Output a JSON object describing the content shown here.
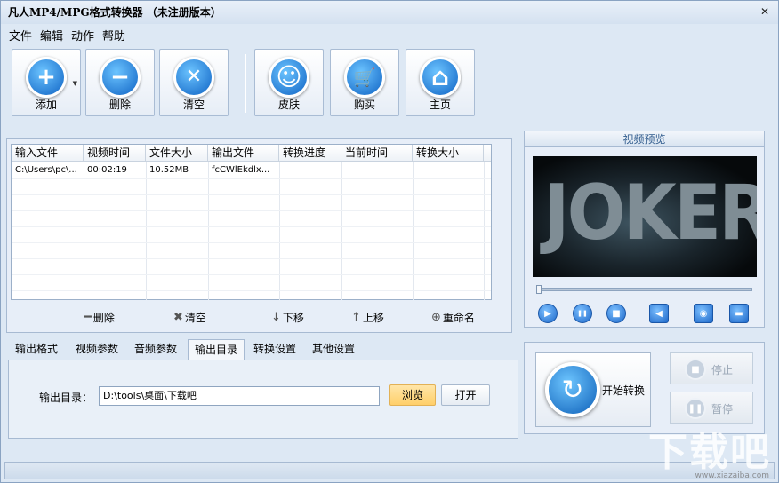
{
  "window": {
    "title": "凡人MP4/MPG格式转换器 （未注册版本）",
    "minimize_glyph": "—",
    "close_glyph": "✕"
  },
  "menu": [
    "文件",
    "编辑",
    "动作",
    "帮助"
  ],
  "toolbar": [
    {
      "label": "添加",
      "icon": "plus-icon",
      "color": "#1f7fe0",
      "glyph": "+"
    },
    {
      "label": "删除",
      "icon": "minus-icon",
      "color": "#1f7fe0",
      "glyph": "−"
    },
    {
      "label": "清空",
      "icon": "clear-icon",
      "color": "#1f7fe0",
      "glyph": "✕"
    },
    {
      "label": "皮肤",
      "icon": "smiley-icon",
      "color": "#1f7fe0",
      "glyph": "☺"
    },
    {
      "label": "购买",
      "icon": "cart-icon",
      "color": "#1f7fe0",
      "glyph": "🛒"
    },
    {
      "label": "主页",
      "icon": "home-icon",
      "color": "#1f7fe0",
      "glyph": "⌂"
    }
  ],
  "file_table": {
    "columns": [
      "输入文件",
      "视频时间",
      "文件大小",
      "输出文件",
      "转换进度",
      "当前时间",
      "转换大小"
    ],
    "rows": [
      [
        "C:\\Users\\pc\\...",
        "00:02:19",
        "10.52MB",
        "fcCWlEkdlx...",
        "",
        "",
        ""
      ]
    ]
  },
  "list_actions": [
    {
      "label": "删除",
      "icon": "minus-icon",
      "glyph": "━"
    },
    {
      "label": "清空",
      "icon": "clear-icon",
      "glyph": "✖"
    },
    {
      "label": "下移",
      "icon": "arrow-down-icon",
      "glyph": "↓"
    },
    {
      "label": "上移",
      "icon": "arrow-up-icon",
      "glyph": "↑"
    },
    {
      "label": "重命名",
      "icon": "rename-icon",
      "glyph": "⊕"
    }
  ],
  "tabs": [
    "输出格式",
    "视频参数",
    "音频参数",
    "输出目录",
    "转换设置",
    "其他设置"
  ],
  "active_tab": "输出目录",
  "output_dir": {
    "label": "输出目录：",
    "value": "D:\\tools\\桌面\\下载吧",
    "browse_label": "浏览",
    "open_label": "打开"
  },
  "preview": {
    "title": "视频预览",
    "video_text": "JOKER",
    "seek_position": 0,
    "controls": [
      {
        "icon": "play-icon",
        "glyph": "▶"
      },
      {
        "icon": "pause-icon",
        "glyph": "❚❚"
      },
      {
        "icon": "stop-icon",
        "glyph": "■"
      },
      {
        "icon": "volume-icon",
        "glyph": "◀"
      },
      {
        "icon": "snapshot-icon",
        "glyph": "◉"
      },
      {
        "icon": "folder-icon",
        "glyph": "▬"
      }
    ]
  },
  "convert": {
    "start_label": "开始转换",
    "stop_label": "停止",
    "pause_label": "暂停"
  },
  "watermark": {
    "text": "下载吧",
    "url": "www.xiazaiba.com"
  }
}
